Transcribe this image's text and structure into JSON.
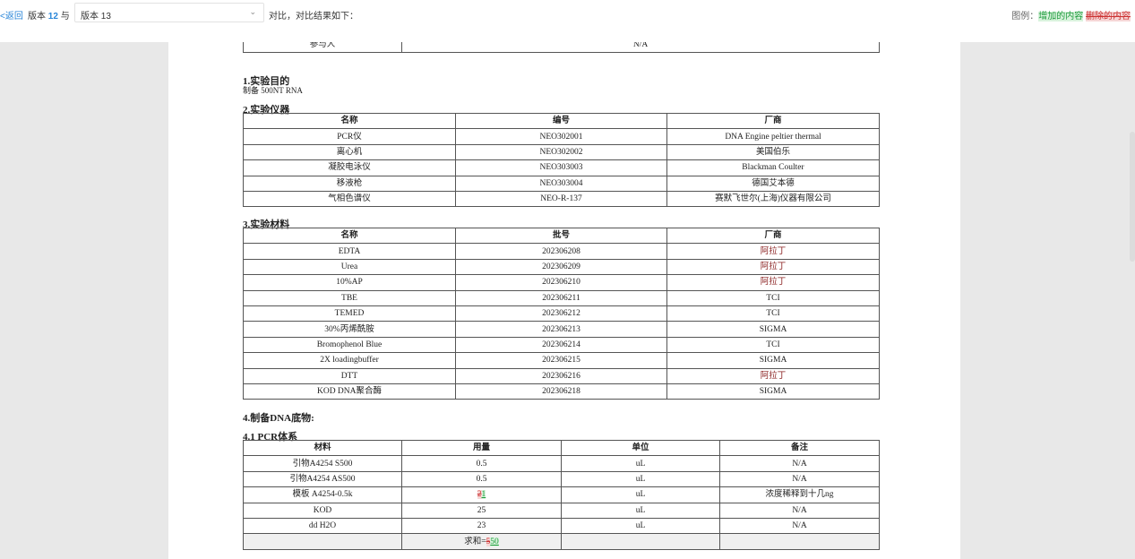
{
  "toolbar": {
    "back_label": "<返回",
    "version_prefix": "版本",
    "version_left": "12",
    "version_joiner": "与",
    "version_select_value": "版本 13",
    "compare_text": "对比，对比结果如下：",
    "legend_label": "图例：",
    "legend_added": "增加的内容",
    "legend_deleted": "删除的内容"
  },
  "document": {
    "top_row": {
      "label": "参与人",
      "value": "N/A"
    },
    "sec1": {
      "title": "1.实验目的",
      "text": "制备 500NT RNA"
    },
    "sec2": {
      "title": "2.实验仪器",
      "headers": [
        "名称",
        "编号",
        "厂商"
      ],
      "rows": [
        [
          "PCR仪",
          "NEO302001",
          "DNA Engine peltier thermal"
        ],
        [
          "离心机",
          "NEO302002",
          "美国伯乐"
        ],
        [
          "凝胶电泳仪",
          "NEO303003",
          "Blackman Coulter"
        ],
        [
          "移液枪",
          "NEO303004",
          "德国艾本德"
        ],
        [
          "气相色谱仪",
          "NEO-R-137",
          "赛默飞世尔(上海)仪器有限公司"
        ]
      ]
    },
    "sec3": {
      "title": "3.实验材料",
      "headers": [
        "名称",
        "批号",
        "厂商"
      ],
      "rows": [
        [
          "EDTA",
          "202306208",
          "阿拉丁"
        ],
        [
          "Urea",
          "202306209",
          "阿拉丁"
        ],
        [
          "10%AP",
          "202306210",
          "阿拉丁"
        ],
        [
          "TBE",
          "202306211",
          "TCI"
        ],
        [
          "TEMED",
          "202306212",
          "TCI"
        ],
        [
          "30%丙烯酰胺",
          "202306213",
          "SIGMA"
        ],
        [
          "Bromophenol Blue",
          "202306214",
          "TCI"
        ],
        [
          "2X loadingbuffer",
          "202306215",
          "SIGMA"
        ],
        [
          "DTT",
          "202306216",
          "阿拉丁"
        ],
        [
          "KOD DNA聚合酶",
          "202306218",
          "SIGMA"
        ]
      ]
    },
    "sec4": {
      "title": "4.制备DNA底物:"
    },
    "sec41": {
      "title": "4.1 PCR体系",
      "headers": [
        "材料",
        "用量",
        "单位",
        "备注"
      ],
      "rows": [
        [
          "引物A4254 S500",
          "0.5",
          "uL",
          "N/A"
        ],
        [
          "引物A4254 AS500",
          "0.5",
          "uL",
          "N/A"
        ],
        [
          "模板 A4254-0.5k",
          "",
          "uL",
          "浓度稀释到十几ng"
        ],
        [
          "KOD",
          "25",
          "uL",
          "N/A"
        ],
        [
          "dd H2O",
          "23",
          "uL",
          "N/A"
        ]
      ],
      "diff_row3_deleted": "2",
      "diff_row3_added": "1",
      "sum_prefix": "求和=",
      "sum_deleted": "5",
      "sum_added": "50"
    }
  },
  "colors": {
    "accent": "#2a86d8",
    "added": "#1c9a3a",
    "deleted": "#cc3333",
    "doc_bg": "#e8e8e8"
  }
}
